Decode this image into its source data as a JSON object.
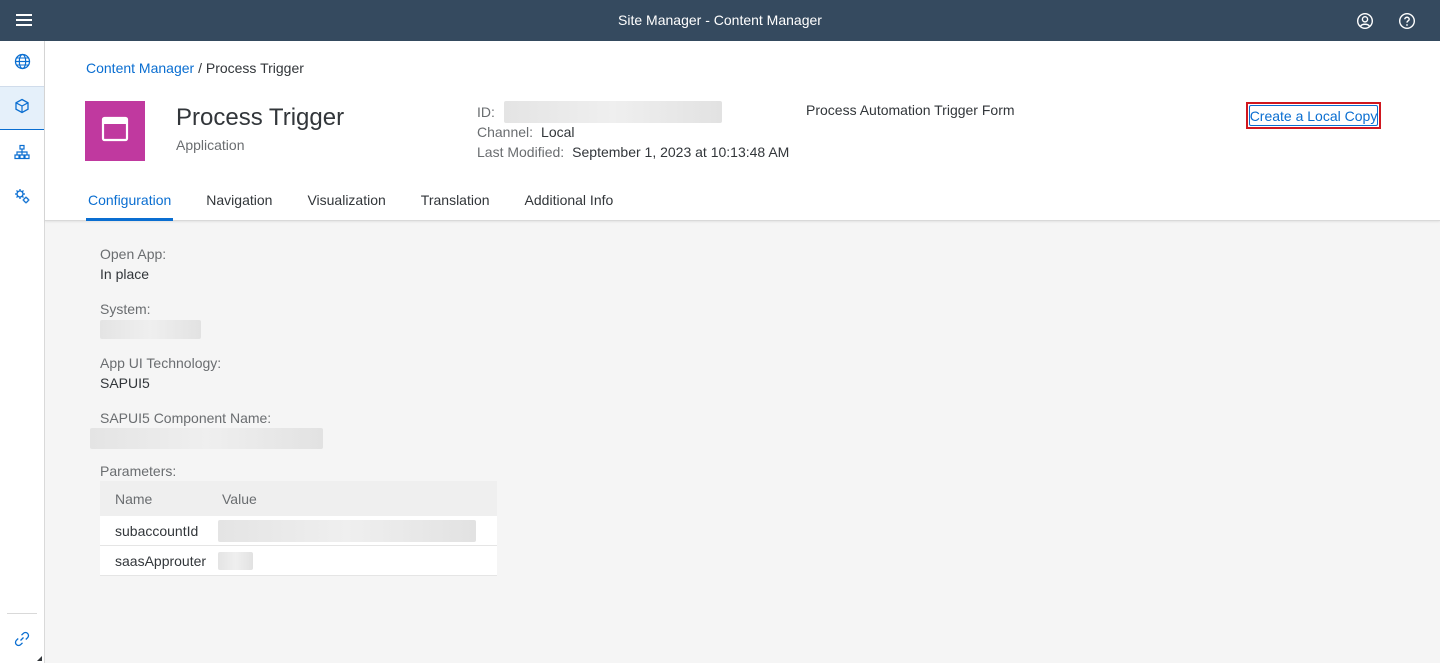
{
  "topbar": {
    "title": "Site Manager - Content Manager",
    "menu_icon": "hamburger-menu-icon",
    "icons": [
      "user-profile-icon",
      "help-icon"
    ]
  },
  "sidenav": {
    "items": [
      {
        "icon": "globe-icon",
        "active": false
      },
      {
        "icon": "cube-icon",
        "active": true
      },
      {
        "icon": "hierarchy-icon",
        "active": false
      },
      {
        "icon": "settings-gears-icon",
        "active": false
      }
    ],
    "bottom_icon": "chain-link-icon"
  },
  "breadcrumb": {
    "link": "Content Manager",
    "separator": "/",
    "current": "Process Trigger"
  },
  "object": {
    "title": "Process Trigger",
    "subtitle": "Application",
    "tile_color": "#c0399f",
    "tile_icon": "application-window-icon",
    "attributes": {
      "id_label": "ID:",
      "channel_label": "Channel:",
      "channel_value": "Local",
      "modified_label": "Last Modified:",
      "modified_value": "September 1, 2023 at 10:13:48 AM"
    },
    "description": "Process Automation Trigger Form",
    "create_copy_label": "Create a Local Copy"
  },
  "tabs": [
    {
      "label": "Configuration",
      "active": true
    },
    {
      "label": "Navigation",
      "active": false
    },
    {
      "label": "Visualization",
      "active": false
    },
    {
      "label": "Translation",
      "active": false
    },
    {
      "label": "Additional Info",
      "active": false
    }
  ],
  "configuration": {
    "open_app_label": "Open App:",
    "open_app_value": "In place",
    "system_label": "System:",
    "ui_tech_label": "App UI Technology:",
    "ui_tech_value": "SAPUI5",
    "component_label": "SAPUI5 Component Name:",
    "parameters_label": "Parameters:",
    "table": {
      "headers": [
        "Name",
        "Value"
      ],
      "rows": [
        {
          "name": "subaccountId"
        },
        {
          "name": "saasApprouter"
        }
      ]
    }
  },
  "colors": {
    "shell": "#354a5f",
    "accent": "#0a6ed1",
    "highlight_border": "#d0171f"
  }
}
